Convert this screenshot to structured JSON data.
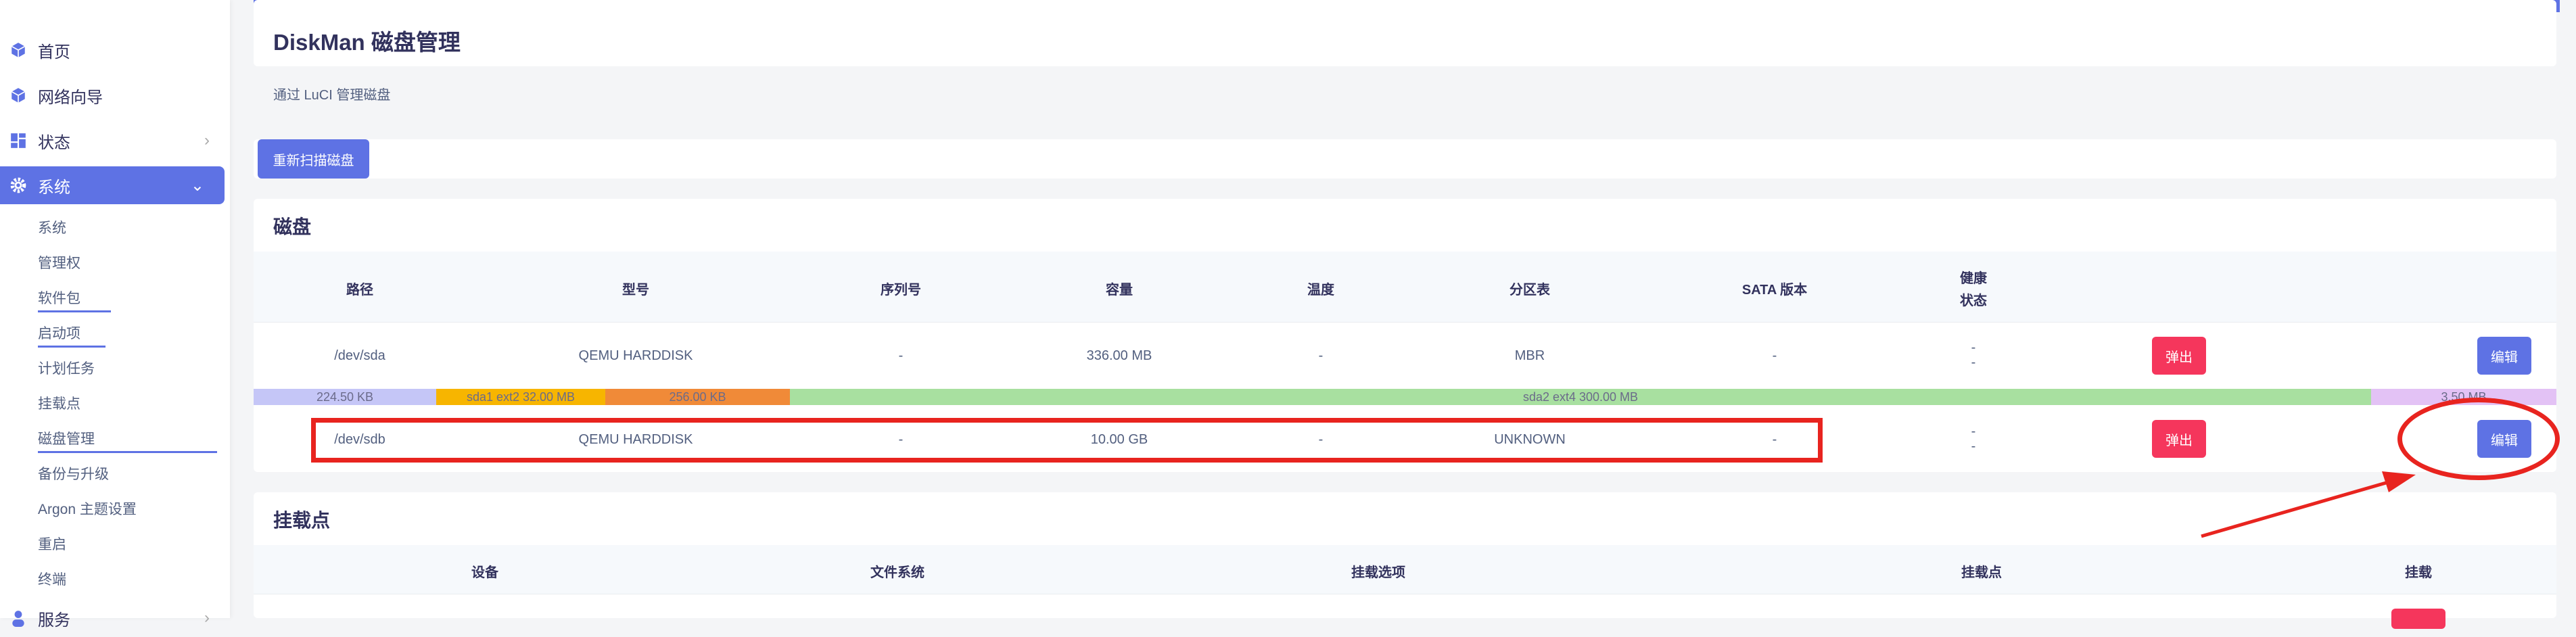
{
  "sidebar": {
    "top_items": [
      {
        "label": "首页",
        "icon": "cube-icon"
      },
      {
        "label": "网络向导",
        "icon": "cube-icon"
      },
      {
        "label": "状态",
        "icon": "dashboard-icon"
      },
      {
        "label": "系统",
        "icon": "gear-icon"
      }
    ],
    "sub_items": [
      "系统",
      "管理权",
      "软件包",
      "启动项",
      "计划任务",
      "挂载点",
      "磁盘管理",
      "备份与升级",
      "Argon 主题设置",
      "重启",
      "终端"
    ],
    "partial_item": "服务"
  },
  "page": {
    "title": "DiskMan 磁盘管理",
    "description": "通过 LuCI 管理磁盘",
    "rescan_label": "重新扫描磁盘"
  },
  "disks": {
    "title": "磁盘",
    "headers": {
      "path": "路径",
      "model": "型号",
      "serial": "序列号",
      "size": "容量",
      "temp": "温度",
      "ptable": "分区表",
      "sata": "SATA 版本",
      "health_1": "健康",
      "health_2": "状态"
    },
    "rows": [
      {
        "path": "/dev/sda",
        "model": "QEMU HARDDISK",
        "serial": "-",
        "size": "336.00 MB",
        "temp": "-",
        "ptable": "MBR",
        "sata": "-",
        "health_1": "-",
        "health_2": "-",
        "eject": "弹出",
        "edit": "编辑"
      },
      {
        "path": "/dev/sdb",
        "model": "QEMU HARDDISK",
        "serial": "-",
        "size": "10.00 GB",
        "temp": "-",
        "ptable": "UNKNOWN",
        "sata": "-",
        "health_1": "-",
        "health_2": "-",
        "eject": "弹出",
        "edit": "编辑"
      }
    ],
    "partitions": [
      {
        "label": "224.50 KB",
        "color": "#c5c6f7"
      },
      {
        "label": "sda1 ext2 32.00 MB",
        "color": "#f7b500"
      },
      {
        "label": "256.00 KB",
        "color": "#f08a38"
      },
      {
        "label": "sda2 ext4 300.00 MB",
        "color": "#a8e0a0"
      },
      {
        "label": "3.50 MB",
        "color": "#e3c2f5"
      }
    ]
  },
  "mounts": {
    "title": "挂载点",
    "headers": {
      "device": "设备",
      "fs": "文件系统",
      "options": "挂载选项",
      "mountpoint": "挂载点",
      "mount": "挂载"
    }
  },
  "colors": {
    "accent": "#5e72e4",
    "danger": "#f5365c",
    "annotation": "#e8241f"
  }
}
